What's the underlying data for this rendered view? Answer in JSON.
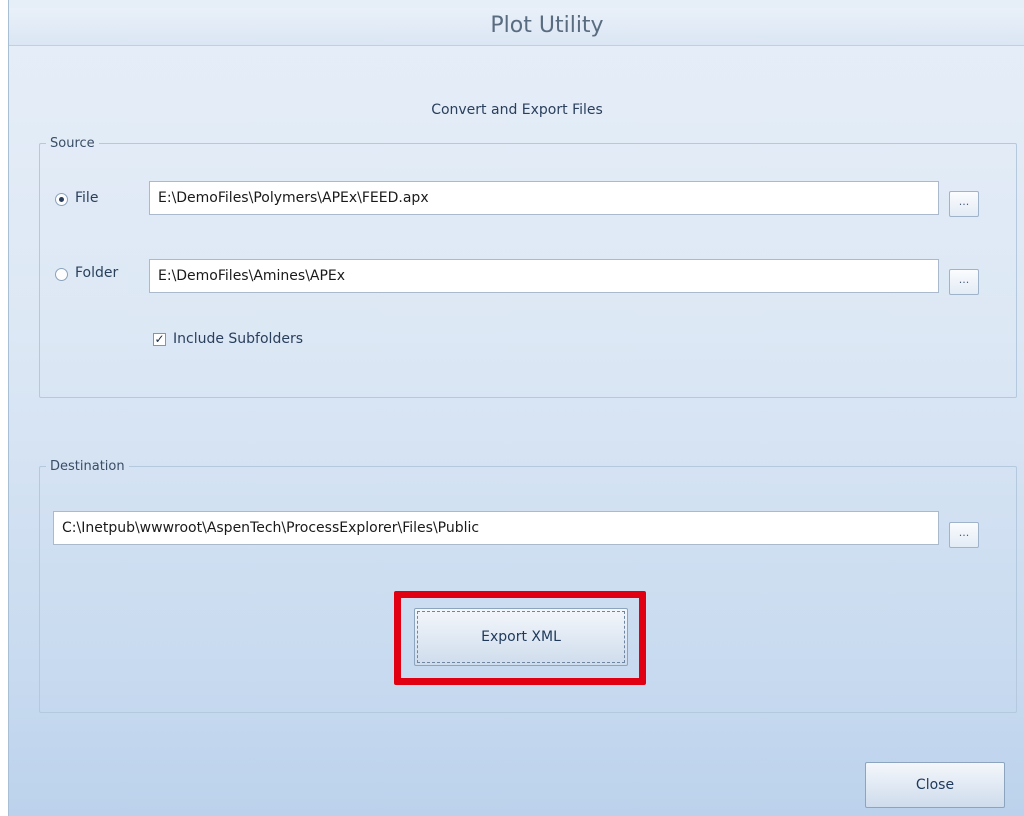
{
  "window": {
    "title": "Plot Utility",
    "subtitle": "Convert and Export Files"
  },
  "source": {
    "legend": "Source",
    "file_option": {
      "label": "File",
      "selected": true,
      "value": "E:\\DemoFiles\\Polymers\\APEx\\FEED.apx"
    },
    "folder_option": {
      "label": "Folder",
      "selected": false,
      "value": "E:\\DemoFiles\\Amines\\APEx"
    },
    "include_subfolders": {
      "label": "Include Subfolders",
      "checked": true,
      "mark": "✓"
    },
    "browse_label": "..."
  },
  "destination": {
    "legend": "Destination",
    "value": "C:\\Inetpub\\wwwroot\\AspenTech\\ProcessExplorer\\Files\\Public",
    "browse_label": "..."
  },
  "buttons": {
    "export_label": "Export XML",
    "close_label": "Close"
  },
  "colors": {
    "highlight": "#e00012",
    "window_gradient_top": "#e6eef8",
    "window_gradient_bottom": "#bcd2ec"
  }
}
